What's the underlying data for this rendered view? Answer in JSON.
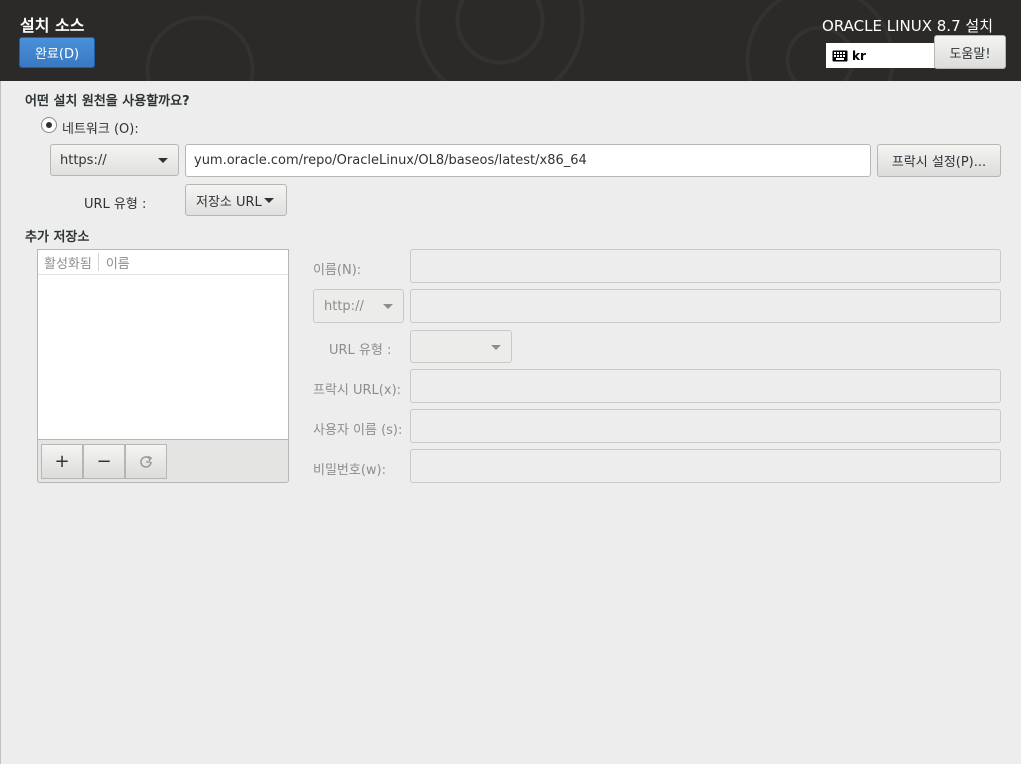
{
  "header": {
    "title": "설치 소스",
    "done_label": "완료(D)",
    "product": "ORACLE LINUX 8.7 설치",
    "keyboard_layout": "kr",
    "help_label": "도움말!"
  },
  "source": {
    "question": "어떤 설치 원천을 사용할까요?",
    "network_option": "네트워크 (O):",
    "network_selected": true,
    "protocol": "https://",
    "url": "yum.oracle.com/repo/OracleLinux/OL8/baseos/latest/x86_64",
    "proxy_button": "프락시 설정(P)...",
    "url_type_label": "URL 유형 :",
    "url_type": "저장소 URL"
  },
  "additional": {
    "heading": "추가 저장소",
    "columns": {
      "enabled": "활성화됨",
      "name": "이름"
    },
    "rows": [],
    "add_symbol": "+",
    "remove_symbol": "−",
    "refresh_icon": "refresh-icon",
    "name_label": "이름(N):",
    "name_value": "",
    "protocol": "http://",
    "url_value": "",
    "url_type_label": "URL 유형 :",
    "url_type_value": "",
    "proxy_label": "프락시 URL(x):",
    "proxy_value": "",
    "username_label": "사용자 이름 (s):",
    "username_value": "",
    "password_label": "비밀번호(w):",
    "password_value": ""
  },
  "colors": {
    "header_bg": "#2b2a28",
    "accent": "#3a79c4",
    "page_bg": "#ededed"
  }
}
